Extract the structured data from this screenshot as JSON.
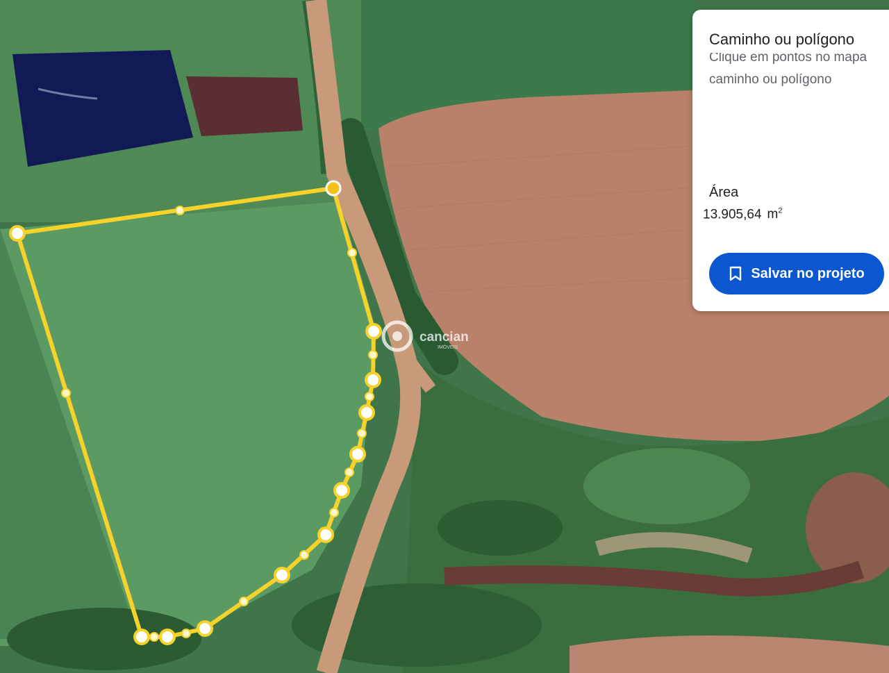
{
  "panel": {
    "title": "Caminho ou polígono",
    "instruction_line1": "Clique em pontos no mapa",
    "instruction_line2": "caminho ou polígono",
    "area_label": "Área",
    "area_value": "13.905,64",
    "area_unit": "m",
    "area_unit_exp": "2",
    "save_label": "Salvar no projeto",
    "save_icon": "bookmark-icon"
  },
  "watermark": {
    "brand": "cancian",
    "sub": "IMÓVEIS"
  },
  "colors": {
    "polygon_line": "#f6d22a",
    "vertex_fill": "#ffffff",
    "vertex_active": "#f6c21a",
    "save_button": "#0b57d0",
    "bare_field": "#b9806a",
    "dirt_road": "#c89a7a",
    "pond": "#111a55"
  }
}
